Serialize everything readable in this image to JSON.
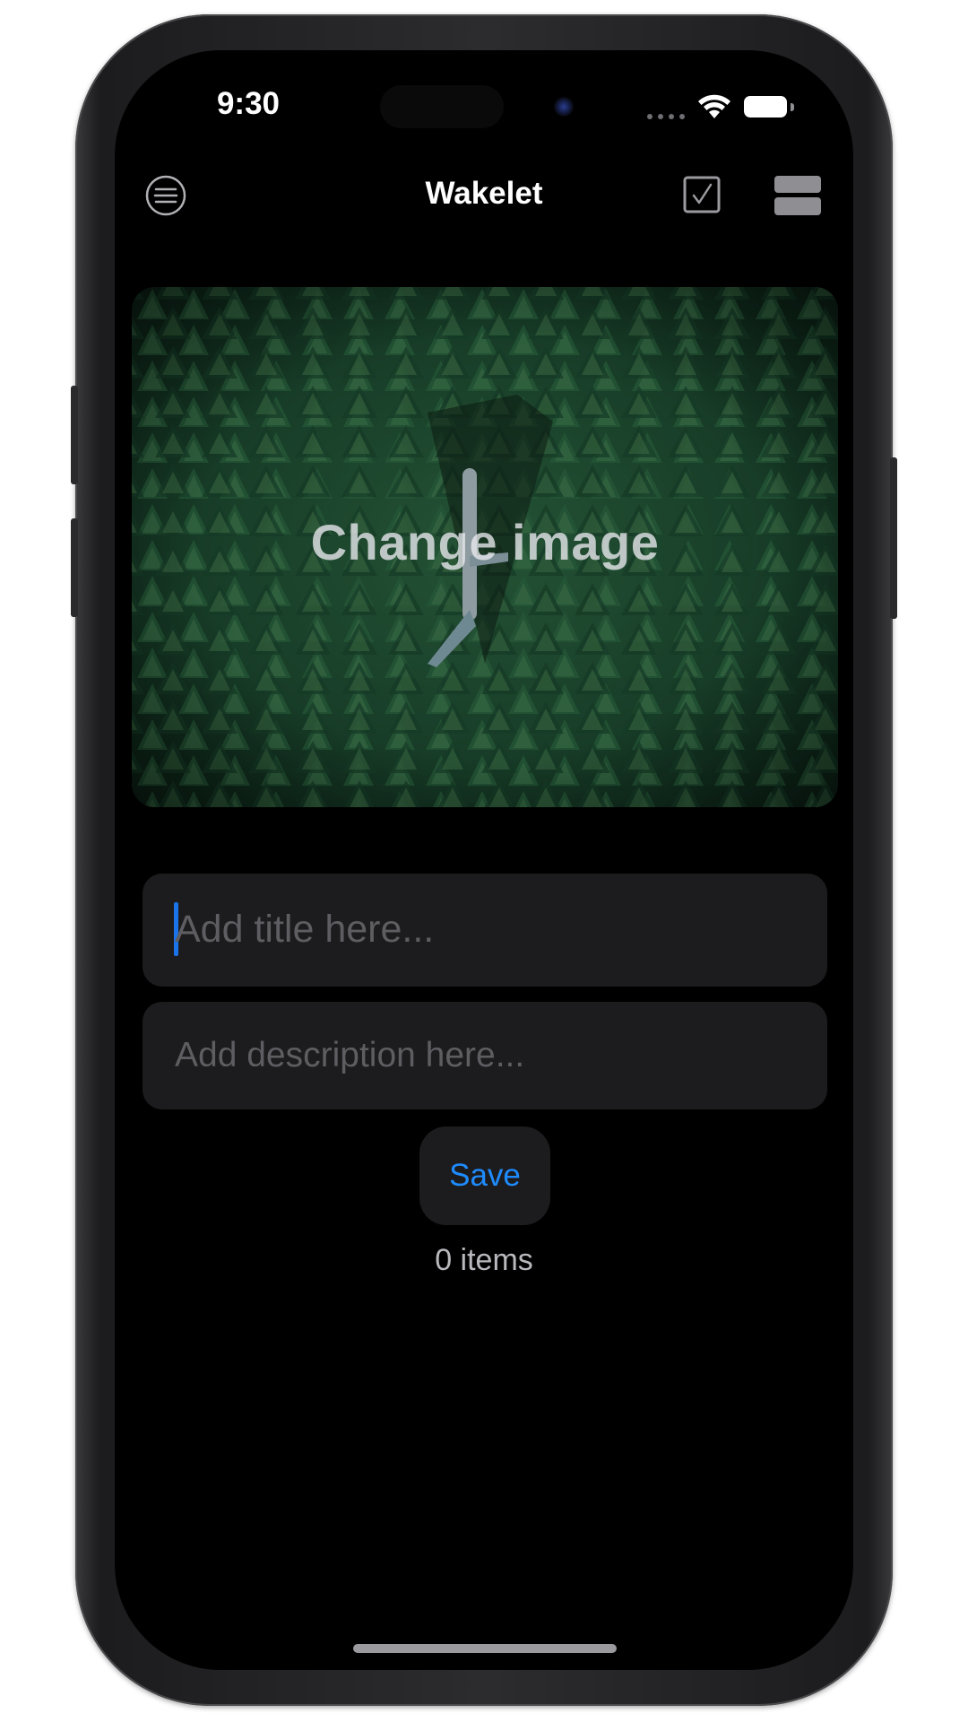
{
  "status_bar": {
    "time": "9:30",
    "icons": [
      "cellular-dots-icon",
      "wifi-icon",
      "battery-icon"
    ]
  },
  "nav": {
    "title": "Wakelet",
    "left_icon": "menu-icon",
    "right_icons": [
      "checkbox-icon",
      "layout-toggle-icon"
    ]
  },
  "cover": {
    "label": "Change image",
    "image_description": "aerial forest with airplane"
  },
  "form": {
    "title_placeholder": "Add title here...",
    "title_value": "",
    "description_placeholder": "Add description here...",
    "description_value": "",
    "save_label": "Save"
  },
  "footer": {
    "items_count": "0 items"
  },
  "colors": {
    "background": "#000000",
    "field_bg": "#1c1c1e",
    "accent": "#1e8bff",
    "caret": "#1a73e8"
  }
}
